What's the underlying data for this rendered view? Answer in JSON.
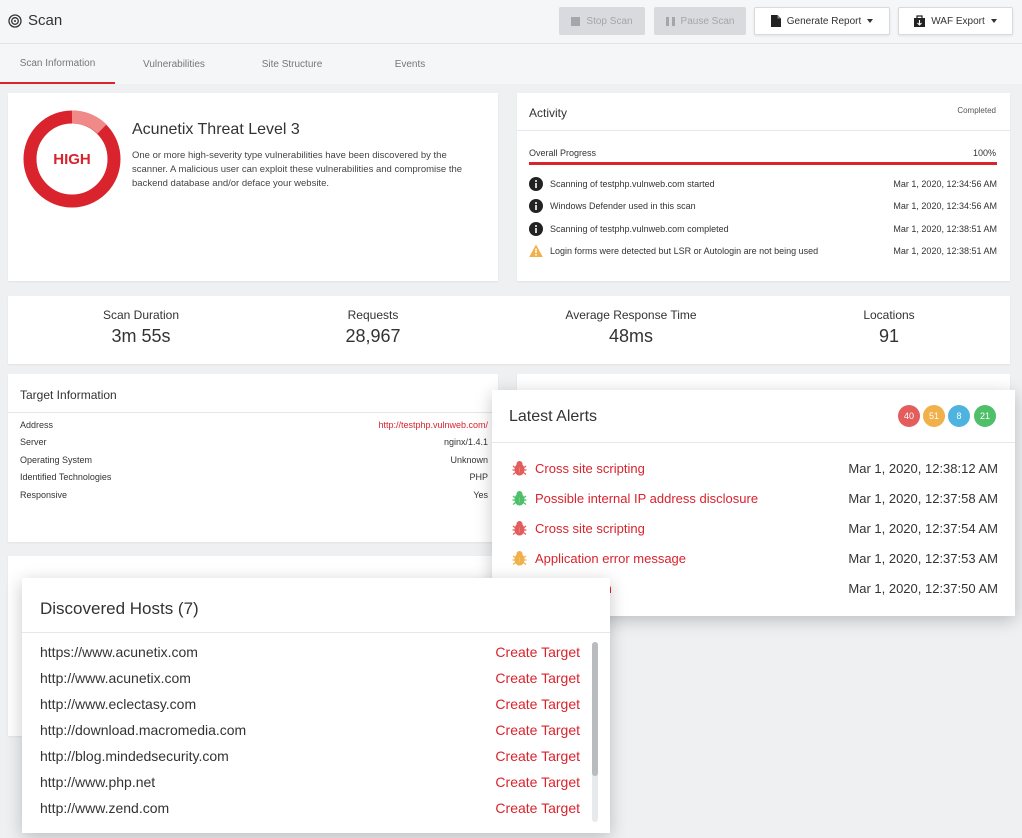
{
  "header": {
    "title": "Scan",
    "stop_scan": "Stop Scan",
    "pause_scan": "Pause Scan",
    "generate_report": "Generate Report",
    "waf_export": "WAF Export"
  },
  "tabs": [
    {
      "label": "Scan Information"
    },
    {
      "label": "Vulnerabilities"
    },
    {
      "label": "Site Structure"
    },
    {
      "label": "Events"
    }
  ],
  "threat": {
    "badge": "HIGH",
    "title": "Acunetix Threat Level 3",
    "description": "One or more high-severity type vulnerabilities have been discovered by the scanner. A malicious user can exploit these vulnerabilities and compromise the backend database and/or deface your website.",
    "colors": {
      "ring": "#d9232d",
      "ring_light": "#f08a88"
    }
  },
  "activity": {
    "title": "Activity",
    "status": "Completed",
    "progress_label": "Overall Progress",
    "progress_pct": "100%",
    "progress_value": 1.0,
    "items": [
      {
        "icon": "info-icon",
        "message": "Scanning of testphp.vulnweb.com started",
        "time": "Mar 1, 2020, 12:34:56 AM"
      },
      {
        "icon": "info-icon",
        "message": "Windows Defender used in this scan",
        "time": "Mar 1, 2020, 12:34:56 AM"
      },
      {
        "icon": "info-icon",
        "message": "Scanning of testphp.vulnweb.com completed",
        "time": "Mar 1, 2020, 12:38:51 AM"
      },
      {
        "icon": "warning-icon",
        "message": "Login forms were detected but LSR or Autologin are not being used",
        "time": "Mar 1, 2020, 12:38:51 AM"
      }
    ]
  },
  "stats": [
    {
      "label": "Scan Duration",
      "value": "3m 55s"
    },
    {
      "label": "Requests",
      "value": "28,967"
    },
    {
      "label": "Average Response Time",
      "value": "48ms"
    },
    {
      "label": "Locations",
      "value": "91"
    }
  ],
  "target_info": {
    "title": "Target Information",
    "rows": [
      {
        "label": "Address",
        "value": "http://testphp.vulnweb.com/",
        "link": true
      },
      {
        "label": "Server",
        "value": "nginx/1.4.1",
        "link": false
      },
      {
        "label": "Operating System",
        "value": "Unknown",
        "link": false
      },
      {
        "label": "Identified Technologies",
        "value": "PHP",
        "link": false
      },
      {
        "label": "Responsive",
        "value": "Yes",
        "link": false
      }
    ]
  },
  "latest_alerts": {
    "title": "Latest Alerts",
    "badges": [
      {
        "count": "40",
        "color": "#e35d5d"
      },
      {
        "count": "51",
        "color": "#f0b04a"
      },
      {
        "count": "8",
        "color": "#4fb3e0"
      },
      {
        "count": "21",
        "color": "#4fbf6a"
      }
    ],
    "items": [
      {
        "name": "Cross site scripting",
        "time": "Mar 1, 2020, 12:38:12 AM",
        "color": "#e35d5d"
      },
      {
        "name": "Possible internal IP address disclosure",
        "time": "Mar 1, 2020, 12:37:58 AM",
        "color": "#4fbf6a"
      },
      {
        "name": "Cross site scripting",
        "time": "Mar 1, 2020, 12:37:54 AM",
        "color": "#e35d5d"
      },
      {
        "name": "Application error message",
        "time": "Mar 1, 2020, 12:37:53 AM",
        "color": "#f0b04a"
      },
      {
        "name": "SQL injection",
        "time": "Mar 1, 2020, 12:37:50 AM",
        "color": "#e35d5d"
      }
    ]
  },
  "discovered_hosts": {
    "title": "Discovered Hosts (7)",
    "action_label": "Create Target",
    "hosts": [
      "https://www.acunetix.com",
      "http://www.acunetix.com",
      "http://www.eclectasy.com",
      "http://download.macromedia.com",
      "http://blog.mindedsecurity.com",
      "http://www.php.net",
      "http://www.zend.com"
    ]
  }
}
